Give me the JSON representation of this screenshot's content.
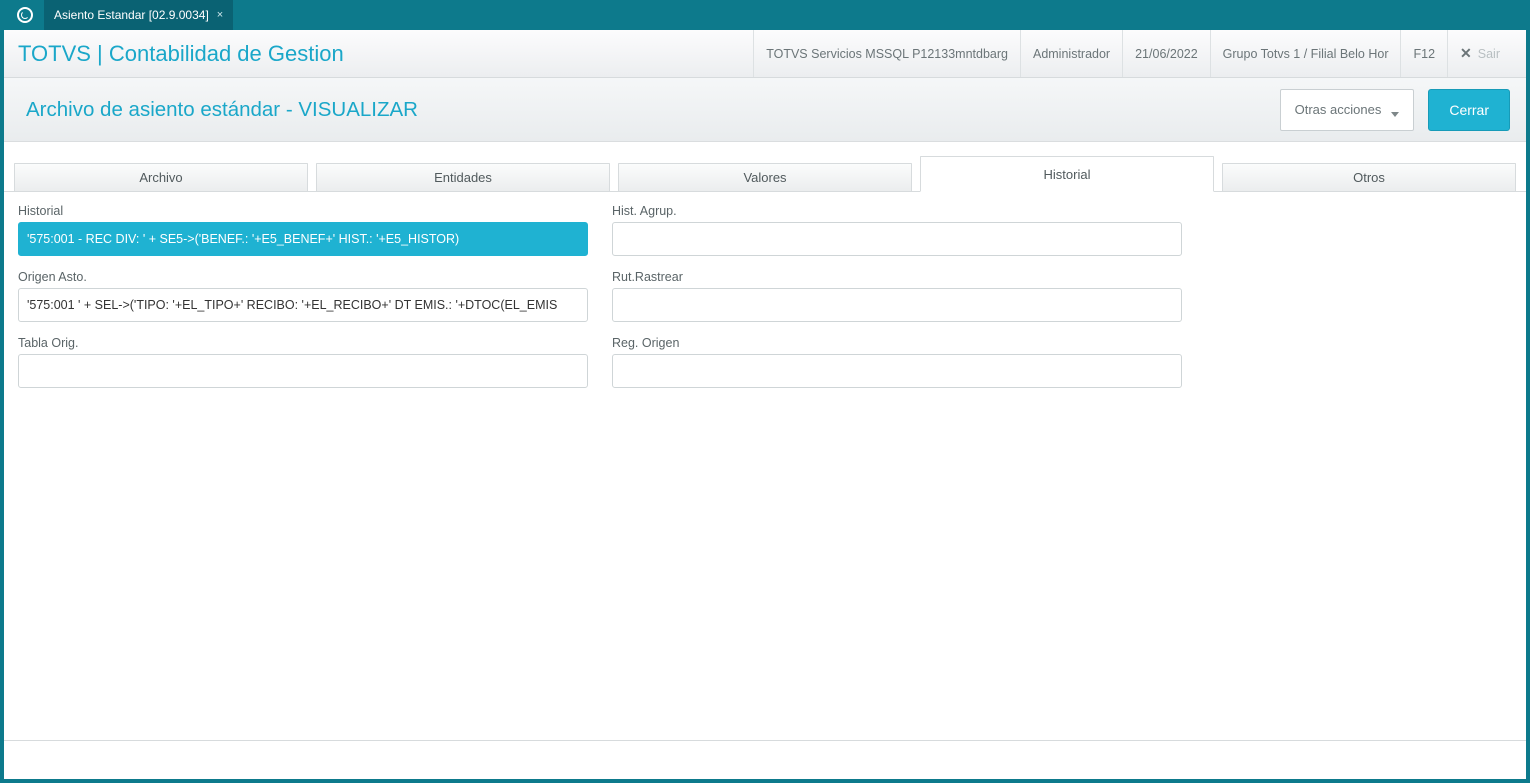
{
  "window": {
    "tab_title": "Asiento Estandar [02.9.0034]"
  },
  "header": {
    "app_title": "TOTVS | Contabilidad de Gestion",
    "env": "TOTVS Servicios MSSQL P12133mntdbarg",
    "user": "Administrador",
    "date": "21/06/2022",
    "branch": "Grupo Totvs 1 / Filial Belo Hor",
    "hotkey": "F12",
    "exit_label": "Sair"
  },
  "toolbar": {
    "title": "Archivo de asiento estándar - VISUALIZAR",
    "other_actions_label": "Otras acciones",
    "close_label": "Cerrar"
  },
  "tabs": [
    {
      "id": "archivo",
      "label": "Archivo",
      "active": false
    },
    {
      "id": "entidades",
      "label": "Entidades",
      "active": false
    },
    {
      "id": "valores",
      "label": "Valores",
      "active": false
    },
    {
      "id": "historial",
      "label": "Historial",
      "active": true
    },
    {
      "id": "otros",
      "label": "Otros",
      "active": false
    }
  ],
  "fields": {
    "historial": {
      "label": "Historial",
      "value": "'575:001 - REC DIV: ' + SE5->('BENEF.: '+E5_BENEF+' HIST.: '+E5_HISTOR)",
      "selected": true
    },
    "hist_agrup": {
      "label": "Hist. Agrup.",
      "value": ""
    },
    "origen_asto": {
      "label": "Origen Asto.",
      "value": "'575:001 ' + SEL->('TIPO: '+EL_TIPO+' RECIBO: '+EL_RECIBO+' DT EMIS.: '+DTOC(EL_EMIS"
    },
    "rut_rastrear": {
      "label": "Rut.Rastrear",
      "value": ""
    },
    "tabla_orig": {
      "label": "Tabla Orig.",
      "value": ""
    },
    "reg_origen": {
      "label": "Reg. Origen",
      "value": ""
    }
  }
}
